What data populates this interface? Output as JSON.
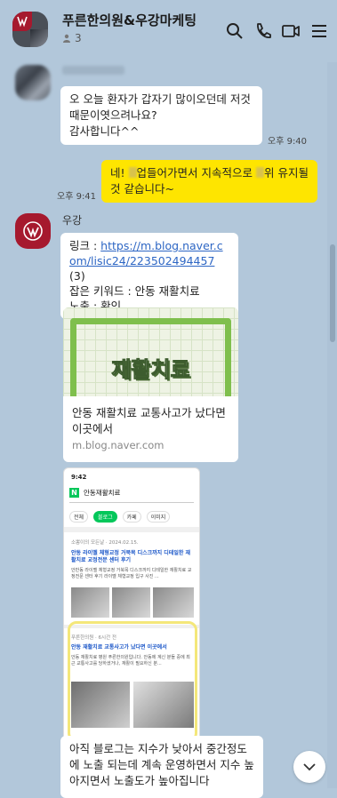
{
  "header": {
    "title": "푸른한의원&우강마케팅",
    "member_count": "3",
    "icons": [
      "search-icon",
      "phone-icon",
      "video-icon",
      "menu-icon"
    ]
  },
  "messages": {
    "m1": {
      "text": "오 오늘 환자가 갑자기 많이오던데 저것 때문이엿으려나요?\n감사합니다^^",
      "time": "오후 9:40"
    },
    "m2": {
      "text_a": "네! ",
      "text_b": "업들어가면서 지속적으로",
      "text_c": "위 유지될것 같습니다~",
      "time": "오후 9:41"
    },
    "m3": {
      "sender": "우강",
      "link_label": "링크 : ",
      "link_url": "https://m.blog.naver.com/lisic24/223502494457",
      "link_suffix": " (3)",
      "keyword_line": "잡은 키워드 : 안동 재활치료",
      "exposure_line": "노출 : 확인"
    },
    "card": {
      "thumb_text": "재활치료",
      "title": "안동 재활치료 교통사고가 났다면 이곳에서",
      "domain": "m.blog.naver.com"
    },
    "screenshot": {
      "status_time": "9:42",
      "query": "안동재활치료",
      "tabs": [
        "전체",
        "블로그",
        "카페",
        "이미지"
      ],
      "post1_meta": "소뽕이의 모든날 · 2024.02.15.",
      "post1_title": "안동 라이멜 체형교정 거북목 디스크까지 디테일한 재활치료 교정전문 센터 후기",
      "post1_body": "안반동 라이멜 체형교정 거북목 디스크까지 디테일한 재활치료 교정전문 센터 후기 라이멜 체형교정 입구 사진 ...",
      "post2_meta": "푸른한의원 · 6시간 전",
      "post2_title": "안동 재활치료 교통사고가 났다면 이곳에서",
      "post2_body": "안동 재활치료 병원 푸른한의원입니다. 안동에 계신 분들 중에 최근 교통사고를 당하셨거나, 재활이 필요하신 분..."
    },
    "m4": {
      "text": "아직 블로그는 지수가 낮아서 중간정도에 노출 되는데 계속 운영하면서 지수 높아지면서 노출도가 높아집니다"
    }
  },
  "colors": {
    "chat_bg": "#b2c7da",
    "my_bubble": "#fee500",
    "brand": "#a6192e",
    "naver_green": "#03c75a"
  }
}
